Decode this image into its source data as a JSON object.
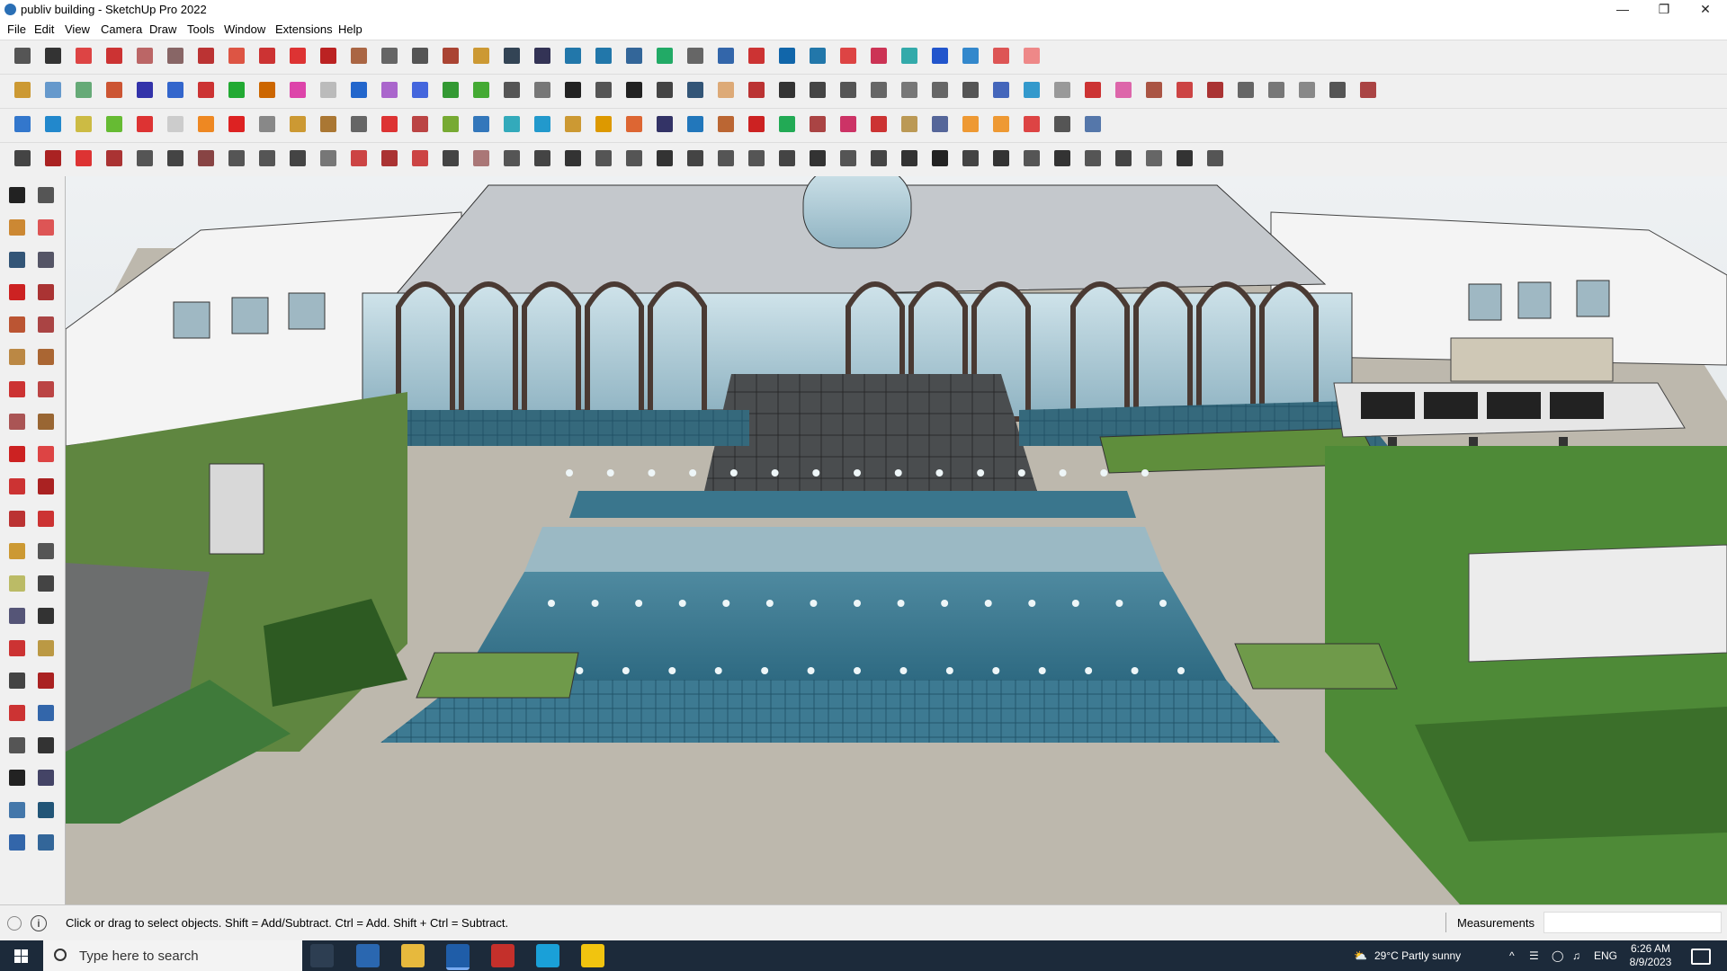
{
  "window": {
    "title": "publiv building - SketchUp Pro 2022",
    "minimize_glyph": "—",
    "maximize_glyph": "❐",
    "close_glyph": "✕"
  },
  "menu": [
    "File",
    "Edit",
    "View",
    "Camera",
    "Draw",
    "Tools",
    "Window",
    "Extensions",
    "Help"
  ],
  "toolbars": {
    "row1_colors": [
      "#555",
      "#333",
      "#d44",
      "#c33",
      "#b66",
      "#866",
      "#b33",
      "#d54",
      "#c33",
      "#d33",
      "#b22",
      "#a64",
      "#666",
      "#555",
      "#a43",
      "#c93",
      "#345",
      "#335",
      "#27a",
      "#27a",
      "#369",
      "#2a6",
      "#666",
      "#36a",
      "#c33",
      "#16a",
      "#27a",
      "#d44",
      "#c35",
      "#3aa",
      "#25c",
      "#38c",
      "#d55",
      "#e88"
    ],
    "row2_colors": [
      "#c93",
      "#69c",
      "#6a7",
      "#c53",
      "#33a",
      "#36c",
      "#c33",
      "#2a3",
      "#c60",
      "#d4a",
      "#bbb",
      "#26c",
      "#a6c",
      "#46d",
      "#393",
      "#4a3",
      "#555",
      "#777",
      "#222",
      "#555",
      "#222",
      "#444",
      "#357",
      "#da7",
      "#b33",
      "#333",
      "#444",
      "#555",
      "#666",
      "#777",
      "#666",
      "#555",
      "#46b",
      "#39c",
      "#999",
      "#c33",
      "#d6a",
      "#a54",
      "#c44",
      "#a33",
      "#666",
      "#777",
      "#888",
      "#555",
      "#a44"
    ],
    "row3_colors": [
      "#37c",
      "#28c",
      "#cb4",
      "#6b3",
      "#d33",
      "#ccc",
      "#e82",
      "#d22",
      "#888",
      "#c93",
      "#a73",
      "#666",
      "#d33",
      "#b44",
      "#7a3",
      "#37b",
      "#3ab",
      "#29c",
      "#c93",
      "#d90",
      "#d63",
      "#336",
      "#27b",
      "#b63",
      "#c22",
      "#2a5",
      "#a44",
      "#c36",
      "#c33",
      "#b95",
      "#569",
      "#e93",
      "#e93",
      "#d44",
      "#555",
      "#57a"
    ],
    "row4_colors": [
      "#444",
      "#a22",
      "#d33",
      "#a33",
      "#555",
      "#444",
      "#844",
      "#555",
      "#555",
      "#444",
      "#777",
      "#c44",
      "#a33",
      "#c44",
      "#444",
      "#a77",
      "#555",
      "#444",
      "#333",
      "#555",
      "#555",
      "#333",
      "#444",
      "#555",
      "#555",
      "#444",
      "#333",
      "#555",
      "#444",
      "#333",
      "#222",
      "#444",
      "#333",
      "#555",
      "#333",
      "#555",
      "#444",
      "#666",
      "#333",
      "#555"
    ]
  },
  "left_toolbar": {
    "icons": [
      "select-icon",
      "orbit-icon",
      "paint-bucket-icon",
      "eraser-icon",
      "components-icon",
      "tape-measure-icon",
      "line-icon",
      "freehand-icon",
      "rectangle-icon",
      "rotated-rectangle-icon",
      "circle-icon",
      "polygon-icon",
      "arc-icon",
      "two-point-arc-icon",
      "three-point-arc-icon",
      "pie-icon",
      "move-icon",
      "push-pull-icon",
      "rotate-icon",
      "follow-me-icon",
      "scale-icon",
      "offset-icon",
      "tape-icon",
      "dimension-icon",
      "protractor-icon",
      "text-icon",
      "axes-icon",
      "3d-text-icon",
      "orbit-nav-icon",
      "pan-icon",
      "zoom-icon",
      "zoom-window-icon",
      "zoom-extents-icon",
      "position-camera-icon",
      "look-around-icon",
      "walk-icon",
      "footprints-icon",
      "section-plane-icon",
      "sandbox-icon",
      "tag-icon",
      "layers-icon",
      "warehouse-icon"
    ],
    "colors": [
      "#222",
      "#555",
      "#c83",
      "#d55",
      "#357",
      "#556",
      "#c22",
      "#a33",
      "#b53",
      "#a44",
      "#b84",
      "#a63",
      "#c33",
      "#b44",
      "#a55",
      "#963",
      "#c22",
      "#d44",
      "#c33",
      "#a22",
      "#b33",
      "#c33",
      "#c93",
      "#555",
      "#bb6",
      "#444",
      "#557",
      "#333",
      "#c33",
      "#b94",
      "#444",
      "#a22",
      "#c33",
      "#36a",
      "#555",
      "#333",
      "#222",
      "#446",
      "#47a",
      "#257",
      "#36a",
      "#369"
    ]
  },
  "status": {
    "message": "Click or drag to select objects. Shift = Add/Subtract. Ctrl = Add. Shift + Ctrl = Subtract.",
    "hint_glyph": "i",
    "measurements_label": "Measurements"
  },
  "taskbar": {
    "search_placeholder": "Type here to search",
    "weather": "29°C  Partly sunny",
    "tray_arrow": "^",
    "language": "ENG",
    "time": "6:26 AM",
    "date": "8/9/2023",
    "pinned": [
      "task-view",
      "calculator",
      "file-explorer",
      "sketchup",
      "acrobat",
      "edge",
      "sticky-notes"
    ]
  }
}
